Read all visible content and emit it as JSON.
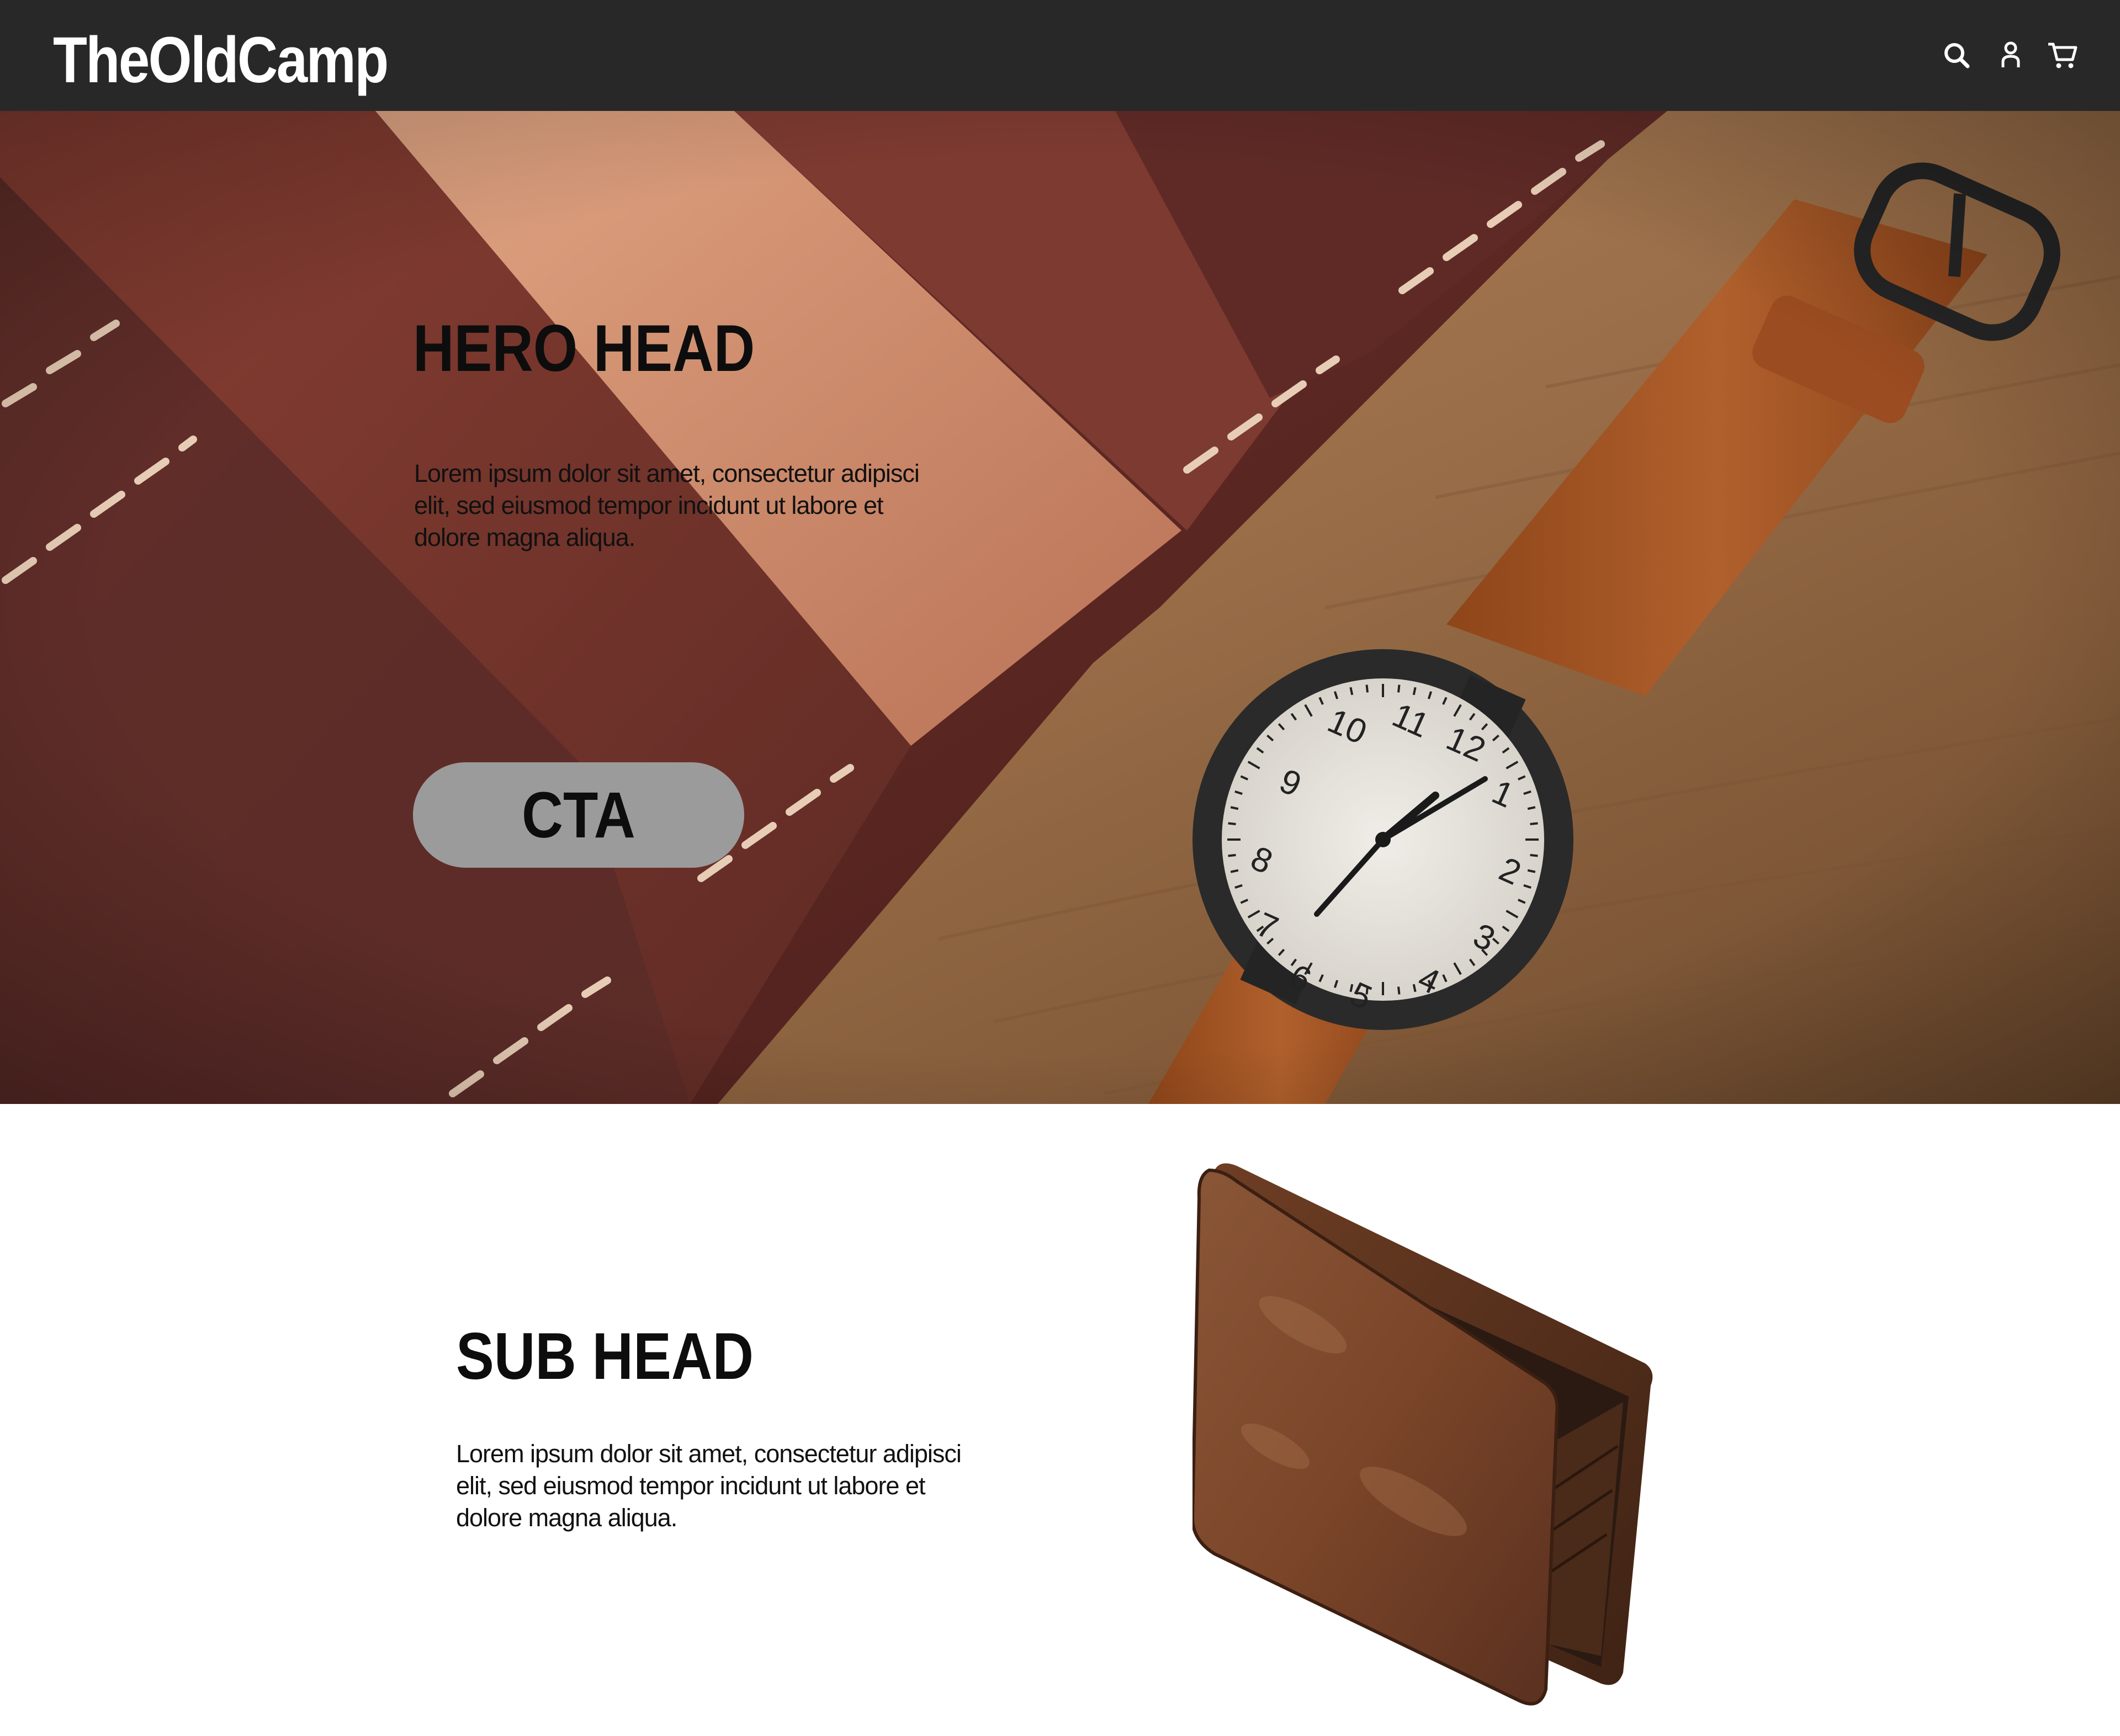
{
  "nav": {
    "logo": "TheOldCamp",
    "icons": [
      "search-icon",
      "account-icon",
      "cart-icon"
    ]
  },
  "hero": {
    "title": "HERO HEAD",
    "body": "Lorem ipsum dolor sit amet, consectetur adipisci elit, sed eiusmod tempor incidunt ut labore et dolore magna aliqua.",
    "cta_label": "CTA",
    "watch_numbers": [
      "10",
      "11",
      "12",
      "1",
      "2",
      "3",
      "4",
      "5",
      "6",
      "7",
      "8",
      "9"
    ]
  },
  "section": {
    "title": "SUB HEAD",
    "body": "Lorem ipsum dolor sit amet, consectetur adipisci elit, sed eiusmod tempor incidunt ut labore et dolore magna aliqua."
  },
  "colors": {
    "nav_bg": "#282828",
    "cta_bg": "#9b9b9b",
    "text": "#0d0d0d",
    "leather_dark": "#5e2a24",
    "leather_tan": "#a55a2a",
    "wood": "#9a6e48"
  }
}
